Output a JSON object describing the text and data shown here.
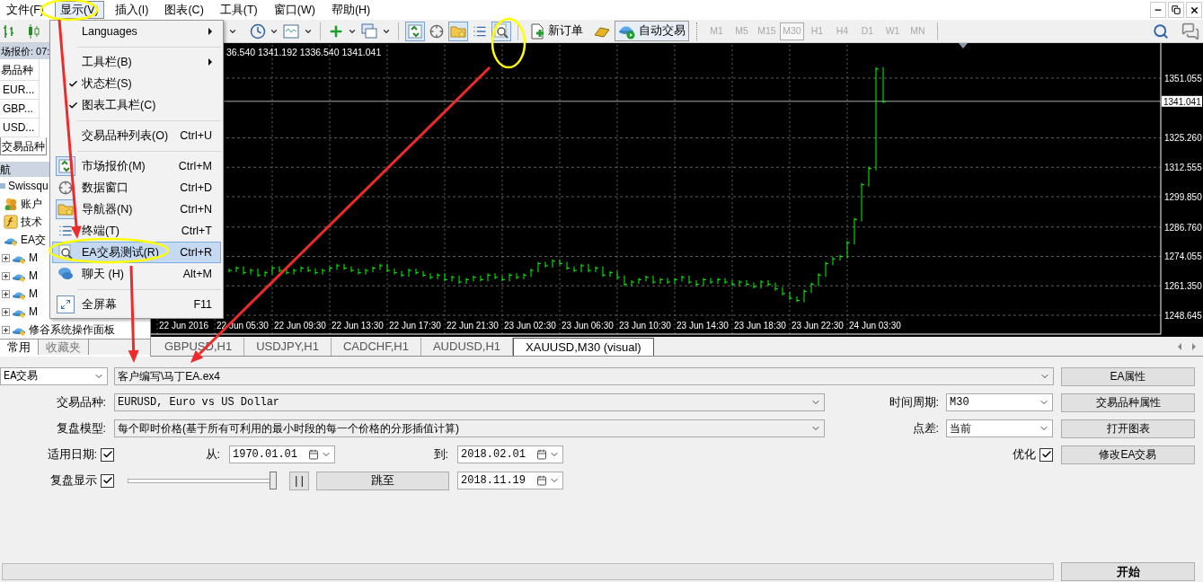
{
  "menu_bar": {
    "items": [
      {
        "label": "文件(F)",
        "selected": false
      },
      {
        "label": "显示(V)",
        "selected": true
      },
      {
        "label": "插入(I)",
        "selected": false
      },
      {
        "label": "图表(C)",
        "selected": false
      },
      {
        "label": "工具(T)",
        "selected": false
      },
      {
        "label": "窗口(W)",
        "selected": false
      },
      {
        "label": "帮助(H)",
        "selected": false
      }
    ]
  },
  "toolbar": {
    "new_order": {
      "label": "新订单",
      "on": false
    },
    "auto_trading": {
      "label": "自动交易",
      "on": true
    }
  },
  "timeframes": [
    {
      "label": "M1",
      "selected": false
    },
    {
      "label": "M5",
      "selected": false
    },
    {
      "label": "M15",
      "selected": false
    },
    {
      "label": "M30",
      "selected": true
    },
    {
      "label": "H1",
      "selected": false
    },
    {
      "label": "H4",
      "selected": false
    },
    {
      "label": "D1",
      "selected": false
    },
    {
      "label": "W1",
      "selected": false
    },
    {
      "label": "MN",
      "selected": false
    }
  ],
  "market_watch": {
    "title": "场报价: 07:",
    "column": "易品种",
    "rows": [
      "EUR...",
      "GBP...",
      "USD..."
    ],
    "tab": "交易品种"
  },
  "navigator": {
    "title": "航",
    "tree": [
      {
        "kind": "server",
        "label": "Swissqu",
        "children": [
          {
            "kind": "accounts",
            "label": "账户"
          },
          {
            "kind": "indicators",
            "label": "技术"
          },
          {
            "kind": "experts",
            "label": "EA交",
            "children": [
              {
                "kind": "expert",
                "label": "M",
                "expanded": false
              },
              {
                "kind": "expert",
                "label": "M",
                "expanded": false
              },
              {
                "kind": "expert",
                "label": "M",
                "expanded": false
              },
              {
                "kind": "expert",
                "label": "M",
                "expanded": false
              },
              {
                "kind": "expert",
                "label": "修谷系统操作面板",
                "expanded": false
              }
            ]
          }
        ]
      }
    ],
    "tabs": [
      {
        "label": "常用",
        "selected": true
      },
      {
        "label": "收藏夹",
        "selected": false
      }
    ]
  },
  "view_menu": {
    "items": [
      {
        "kind": "item",
        "label": "Languages",
        "submenu": true,
        "checked": false,
        "selected": false
      },
      {
        "kind": "separator"
      },
      {
        "kind": "item",
        "label": "工具栏(B)",
        "submenu": true,
        "checked": false,
        "selected": false
      },
      {
        "kind": "item",
        "label": "状态栏(S)",
        "submenu": false,
        "checked": true,
        "selected": false
      },
      {
        "kind": "item",
        "label": "图表工具栏(C)",
        "submenu": false,
        "checked": true,
        "selected": false
      },
      {
        "kind": "separator"
      },
      {
        "kind": "item",
        "label": "交易品种列表(O)",
        "shortcut": "Ctrl+U",
        "submenu": false,
        "checked": false,
        "selected": false
      },
      {
        "kind": "separator"
      },
      {
        "kind": "item",
        "label": "市场报价(M)",
        "shortcut": "Ctrl+M",
        "submenu": false,
        "checked": true,
        "selected": false
      },
      {
        "kind": "item",
        "label": "数据窗口",
        "shortcut": "Ctrl+D",
        "submenu": false,
        "checked": false,
        "selected": false
      },
      {
        "kind": "item",
        "label": "导航器(N)",
        "shortcut": "Ctrl+N",
        "submenu": false,
        "checked": true,
        "selected": false
      },
      {
        "kind": "item",
        "label": "终端(T)",
        "shortcut": "Ctrl+T",
        "submenu": false,
        "checked": false,
        "selected": false
      },
      {
        "kind": "item",
        "label": "EA交易测试(R)",
        "shortcut": "Ctrl+R",
        "submenu": false,
        "checked": false,
        "selected": true
      },
      {
        "kind": "item",
        "label": "聊天 (H)",
        "shortcut": "Alt+M",
        "submenu": false,
        "checked": false,
        "selected": false
      },
      {
        "kind": "separator"
      },
      {
        "kind": "item",
        "label": "全屏幕",
        "shortcut": "F11",
        "submenu": false,
        "checked": false,
        "selected": false
      }
    ]
  },
  "chart": {
    "header": "36.540 1341.192 1336.540 1341.041",
    "price_label": "1341.041",
    "price_axis": [
      "1351.055",
      "1325.260",
      "1312.555",
      "1299.850",
      "1286.760",
      "1274.055",
      "1261.350",
      "1248.645"
    ],
    "time_axis": [
      "22 Jun 2016",
      "22 Jun 05:30",
      "22 Jun 09:30",
      "22 Jun 13:30",
      "22 Jun 17:30",
      "22 Jun 21:30",
      "23 Jun 02:30",
      "23 Jun 06:30",
      "23 Jun 10:30",
      "23 Jun 14:30",
      "23 Jun 18:30",
      "23 Jun 22:30",
      "24 Jun 03:30"
    ]
  },
  "chart_tabs": [
    {
      "label": "GBPUSD,H1",
      "selected": false
    },
    {
      "label": "USDJPY,H1",
      "selected": false
    },
    {
      "label": "CADCHF,H1",
      "selected": false
    },
    {
      "label": "AUDUSD,H1",
      "selected": false
    },
    {
      "label": "XAUUSD,M30 (visual)",
      "selected": true
    }
  ],
  "tester": {
    "mode": "EA交易",
    "expert_file": "客户编写\\马丁EA.ex4",
    "symbol": {
      "label": "交易品种:",
      "value": "EURUSD, Euro vs US Dollar"
    },
    "model": {
      "label": "复盘模型:",
      "value": "每个即时价格(基于所有可利用的最小时段的每一个价格的分形插值计算)"
    },
    "period": {
      "label": "时间周期:",
      "value": "M30"
    },
    "spread": {
      "label": "点差:",
      "value": "当前"
    },
    "use_date": {
      "label": "适用日期:",
      "checked": true
    },
    "from": {
      "label": "从:",
      "value": "1970.01.01"
    },
    "to": {
      "label": "到:",
      "value": "2018.02.01"
    },
    "optimization": {
      "label": "优化",
      "checked": true
    },
    "visual": {
      "label": "复盘显示",
      "checked": true
    },
    "speed": {
      "level": 1
    },
    "pause_button": "| |",
    "skip_button": "跳至",
    "skip_date": "2018.11.19",
    "progress": {
      "level": 0
    },
    "buttons": [
      "EA属性",
      "交易品种属性",
      "打开图表",
      "修改EA交易"
    ],
    "start_button": "开始"
  }
}
